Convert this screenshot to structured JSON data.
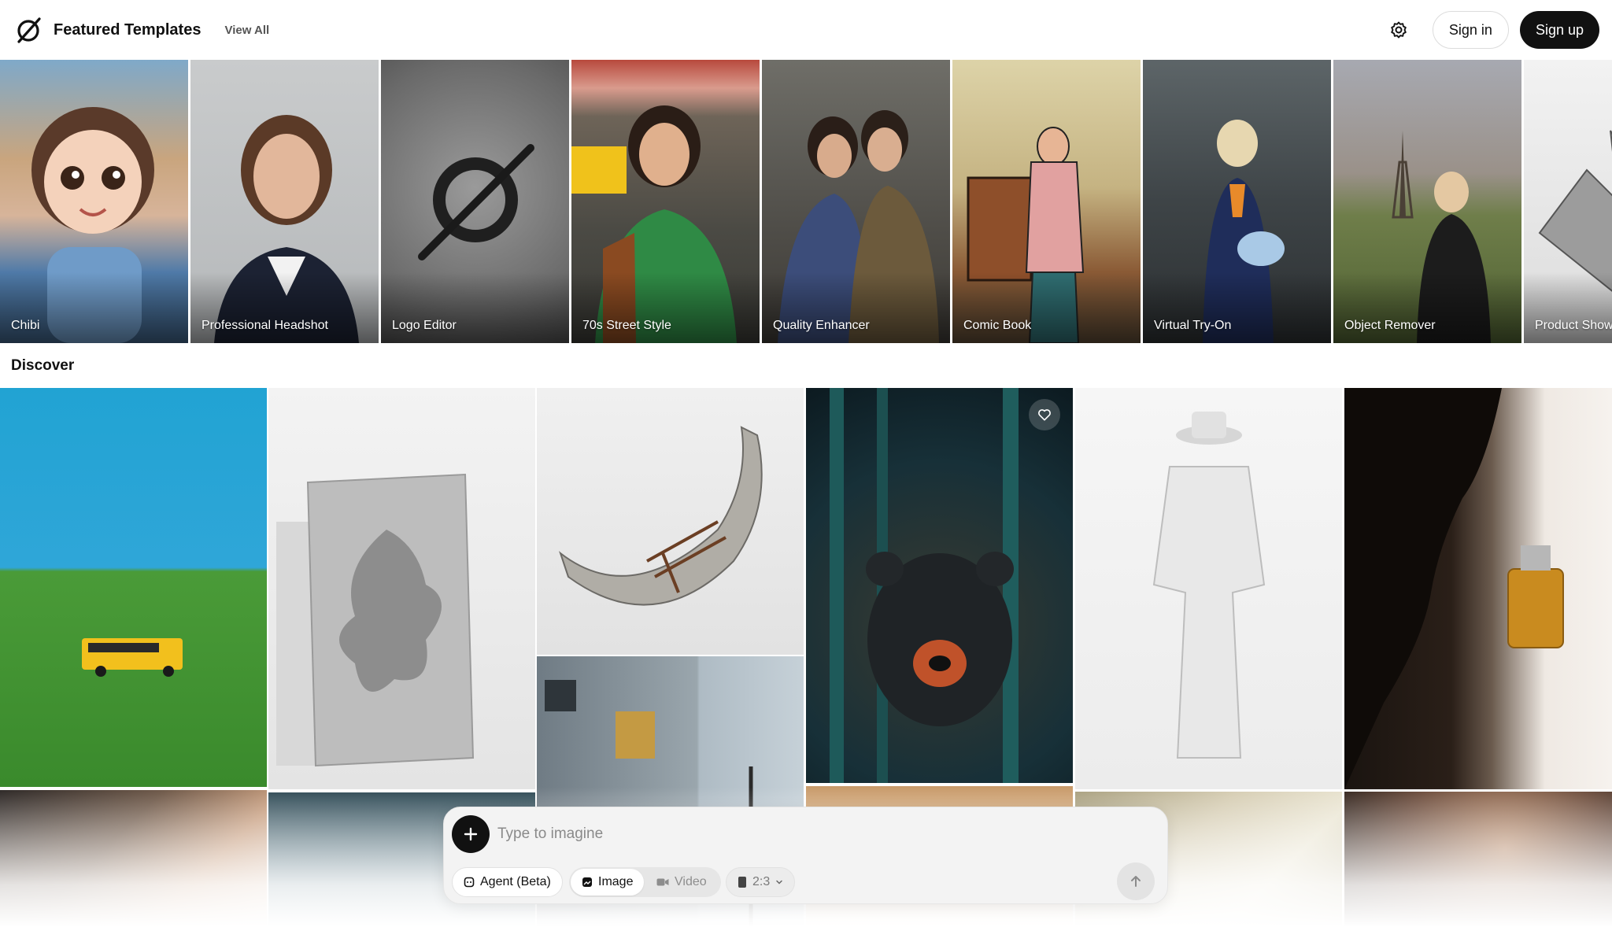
{
  "header": {
    "title": "Featured Templates",
    "view_all": "View All",
    "sign_in": "Sign in",
    "sign_up": "Sign up"
  },
  "templates": [
    {
      "label": "Chibi"
    },
    {
      "label": "Professional Headshot"
    },
    {
      "label": "Logo Editor"
    },
    {
      "label": "70s Street Style"
    },
    {
      "label": "Quality Enhancer"
    },
    {
      "label": "Comic Book"
    },
    {
      "label": "Virtual Try-On"
    },
    {
      "label": "Object Remover"
    },
    {
      "label": "Product Show"
    }
  ],
  "discover": {
    "title": "Discover"
  },
  "prompt": {
    "placeholder": "Type to imagine",
    "agent_label": "Agent (Beta)",
    "image_label": "Image",
    "video_label": "Video",
    "ratio_label": "2:3"
  },
  "colors": {
    "accent": "#111111",
    "background": "#ffffff"
  },
  "icons": [
    "logo-icon",
    "gear-icon",
    "heart-icon",
    "plus-icon",
    "agent-icon",
    "image-icon",
    "video-icon",
    "ratio-icon",
    "chevron-down-icon",
    "arrow-up-icon"
  ]
}
